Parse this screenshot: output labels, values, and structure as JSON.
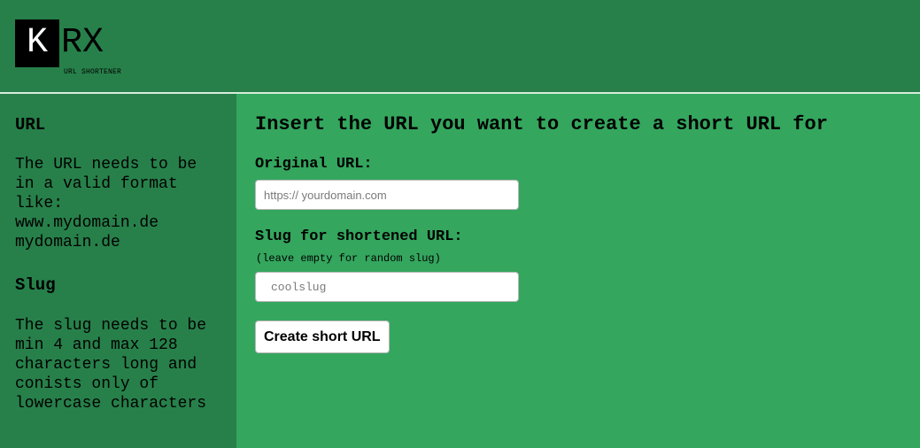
{
  "header": {
    "logo": {
      "box_letter": "K",
      "rest_letters": "RX",
      "subtitle": "URL SHORTENER"
    }
  },
  "sidebar": {
    "sections": [
      {
        "heading": "URL",
        "text": "The URL needs to be in a valid format like:\nwww.mydomain.de\nmydomain.de"
      },
      {
        "heading": "Slug",
        "text": "The slug needs to be min 4 and max 128 characters long and conists only of lowercase characters"
      }
    ]
  },
  "main": {
    "title": "Insert the URL you want to create a short URL for",
    "original_url": {
      "label": "Original URL:",
      "placeholder": "https:// yourdomain.com",
      "value": ""
    },
    "slug": {
      "label": "Slug for shortened URL:",
      "hint": "(leave empty for random slug)",
      "placeholder": "coolslug",
      "value": ""
    },
    "submit_label": "Create short URL"
  },
  "colors": {
    "header_bg": "#27804a",
    "sidebar_bg": "#27804a",
    "main_bg": "#34a65e",
    "logo_box": "#000000"
  }
}
